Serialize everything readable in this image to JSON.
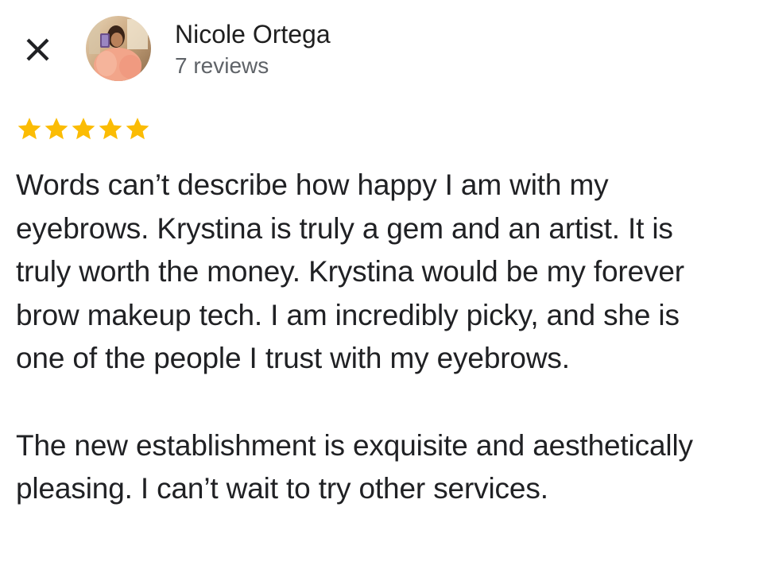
{
  "header": {
    "close_icon": "close-icon",
    "avatar_icon": "avatar",
    "reviewer_name": "Nicole Ortega",
    "review_count": "7 reviews"
  },
  "rating": {
    "stars": 5,
    "out_of": 5,
    "star_color": "#FBBC04"
  },
  "review": {
    "paragraphs": [
      "Words can’t describe how happy I am with my\neyebrows. Krystina is truly a gem and an artist. It is\ntruly worth the money. Krystina would be my forever\nbrow makeup tech. I am incredibly picky, and she is\none of the people I trust with my eyebrows.",
      "The new establishment is exquisite and aesthetically\npleasing. I can’t wait to try other services."
    ]
  },
  "colors": {
    "text_primary": "#202124",
    "text_secondary": "#5f6368",
    "background": "#ffffff"
  }
}
